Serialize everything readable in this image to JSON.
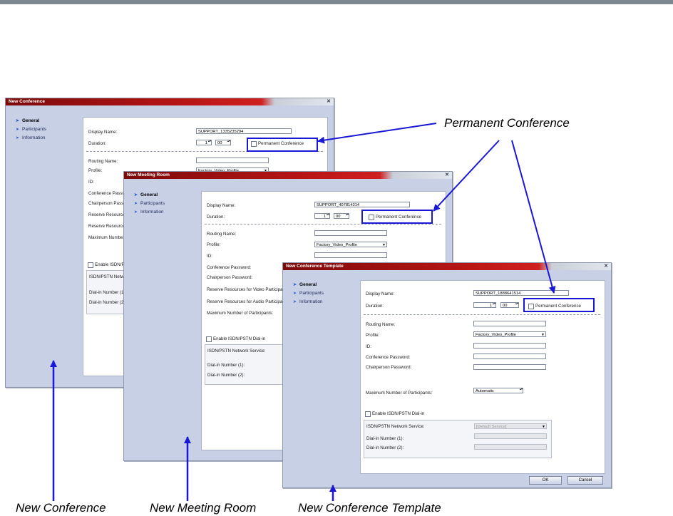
{
  "callouts": {
    "permanent_conference": "Permanent Conference",
    "new_conference": "New Conference",
    "new_meeting_room": "New Meeting Room",
    "new_conference_template": "New Conference Template"
  },
  "colors": {
    "arrow": "#1a18d6",
    "title_bar": "#b81515",
    "dialog_bg": "#c8d0e6"
  },
  "nav": {
    "general": "General",
    "participants": "Participants",
    "information": "Information"
  },
  "dialog1": {
    "title": "New Conference",
    "display_name_label": "Display Name:",
    "display_name": "SUPPORT_1335235294",
    "duration_label": "Duration:",
    "duration_hours": "1",
    "duration_minutes": "00",
    "permanent_label": "Permanent Conference",
    "routing_label": "Routing Name:",
    "profile_label": "Profile:",
    "profile_value": "Factory_Video_Profile",
    "id_label": "ID:",
    "conf_pw_label": "Conference Password:",
    "chair_label": "Chairperson Password:",
    "reserve_video_label": "Reserve Resources for Video Participants:",
    "reserve_audio_label": "Reserve Resources for Audio Participants:",
    "max_label": "Maximum Number of Participants:",
    "enable_isdn_label": "Enable ISDN/PSTN Dial-in",
    "isdn_service_label": "ISDN/PSTN Network Service:",
    "dialin1_label": "Dial-in Number (1):",
    "dialin2_label": "Dial-in Number (2):"
  },
  "dialog2": {
    "title": "New Meeting Room",
    "display_name_label": "Display Name:",
    "display_name": "SUPPORT_407814314",
    "duration_label": "Duration:",
    "duration_hours": "1",
    "duration_minutes": "00",
    "permanent_label": "Permanent Conference",
    "routing_label": "Routing Name:",
    "profile_label": "Profile:",
    "profile_value": "Factory_Video_Profile",
    "id_label": "ID:",
    "conf_pw_label": "Conference Password:",
    "chair_label": "Chairperson Password:",
    "reserve_video_label": "Reserve Resources for Video Participants:",
    "reserve_audio_label": "Reserve Resources for Audio Participants:",
    "max_label": "Maximum Number of Participants:",
    "enable_isdn_label": "Enable ISDN/PSTN Dial-in",
    "isdn_service_label": "ISDN/PSTN Network Service:",
    "dialin1_label": "Dial-in Number (1):",
    "dialin2_label": "Dial-in Number (2):"
  },
  "dialog3": {
    "title": "New Conference Template",
    "display_name_label": "Display Name:",
    "display_name": "SUPPORT_1888641514",
    "duration_label": "Duration:",
    "duration_hours": "1",
    "duration_minutes": "00",
    "permanent_label": "Permanent Conference",
    "routing_label": "Routing Name:",
    "profile_label": "Profile:",
    "profile_value": "Factory_Video_Profile",
    "id_label": "ID:",
    "conf_pw_label": "Conference Password:",
    "chair_label": "Chairperson Password:",
    "max_label": "Maximum Number of Participants:",
    "max_value": "Automatic",
    "enable_isdn_label": "Enable ISDN/PSTN Dial-in",
    "isdn_service_label": "ISDN/PSTN Network Service:",
    "isdn_service_value": "[Default Service]",
    "dialin1_label": "Dial-in Number (1):",
    "dialin2_label": "Dial-in Number (2):",
    "ok": "OK",
    "cancel": "Cancel"
  }
}
